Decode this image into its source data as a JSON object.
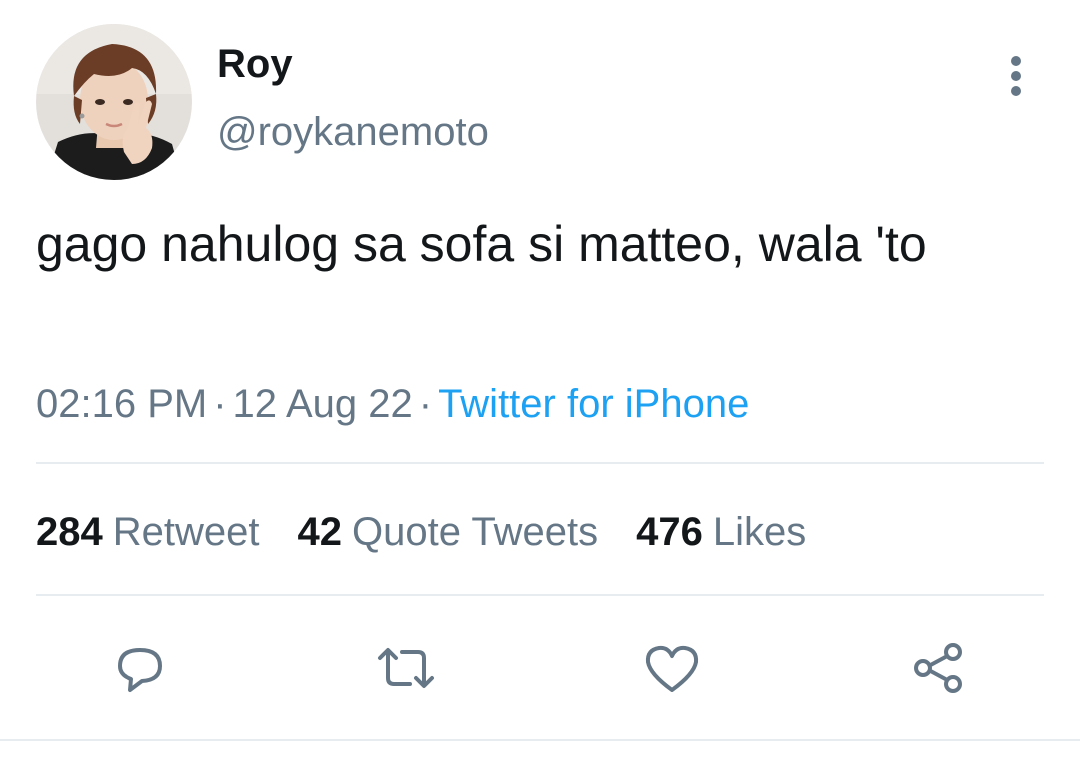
{
  "user": {
    "display_name": "Roy",
    "handle": "@roykanemoto",
    "avatar_icon": "profile-photo"
  },
  "tweet": {
    "text": "gago nahulog sa sofa si matteo, wala 'to",
    "time": "02:16 PM",
    "date": "12 Aug 22",
    "separator": "·",
    "source": "Twitter for iPhone"
  },
  "stats": {
    "retweets": {
      "count": "284",
      "label": "Retweet"
    },
    "quotes": {
      "count": "42",
      "label": "Quote Tweets"
    },
    "likes": {
      "count": "476",
      "label": "Likes"
    }
  },
  "actions": {
    "reply_icon": "comment-icon",
    "retweet_icon": "retweet-icon",
    "like_icon": "heart-icon",
    "share_icon": "share-icon",
    "more_icon": "more-vertical-icon"
  },
  "colors": {
    "text": "#14171a",
    "secondary": "#657786",
    "link": "#1da1f2",
    "divider": "#e6ecf0"
  }
}
